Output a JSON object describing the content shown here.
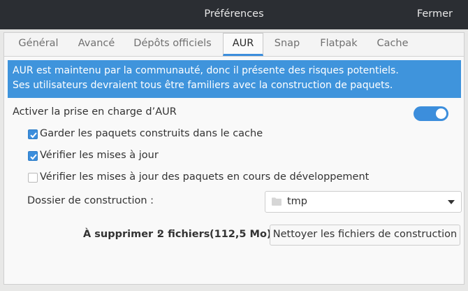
{
  "header": {
    "title": "Préférences",
    "close_label": "Fermer"
  },
  "tabs": [
    {
      "label": "Général"
    },
    {
      "label": "Avancé"
    },
    {
      "label": "Dépôts officiels"
    },
    {
      "label": "AUR",
      "active": true
    },
    {
      "label": "Snap"
    },
    {
      "label": "Flatpak"
    },
    {
      "label": "Cache"
    }
  ],
  "banner": {
    "line1": "AUR est maintenu par la communauté, donc il présente des risques potentiels.",
    "line2": "Ses utilisateurs devraient tous être familiers avec la construction de paquets."
  },
  "aur": {
    "enable_label": "Activer la prise en charge d’AUR",
    "enable_state": true,
    "options": [
      {
        "label": "Garder les paquets construits dans le cache",
        "checked": true
      },
      {
        "label": "Vérifier les mises à jour",
        "checked": true
      },
      {
        "label": "Vérifier les mises à jour des paquets en cours de développement",
        "checked": false
      }
    ],
    "build_dir_label": "Dossier de construction :",
    "build_dir_value": "tmp",
    "to_delete_label": "À supprimer :",
    "to_delete_count": "2 fichiers",
    "to_delete_size": "(112,5 Mo)",
    "clean_button_label": "Nettoyer les fichiers de construction"
  },
  "colors": {
    "accent": "#3c8edc",
    "banner": "#3f94dc",
    "headerbar": "#2b2e33"
  },
  "icons": {
    "folder": "folder-icon",
    "dropdown": "triangle-down-icon",
    "check": "checkmark-icon"
  }
}
